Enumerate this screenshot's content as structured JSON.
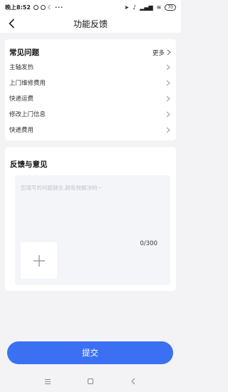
{
  "status_bar": {
    "time": "晚上8:52",
    "battery": "70"
  },
  "header": {
    "title": "功能反馈"
  },
  "faq": {
    "title": "常见问题",
    "more_label": "更多",
    "items": [
      {
        "label": "主轴发热"
      },
      {
        "label": "上门维修费用"
      },
      {
        "label": "快递运费"
      },
      {
        "label": "修改上门信息"
      },
      {
        "label": "快递费用"
      }
    ]
  },
  "feedback": {
    "title": "反馈与意见",
    "placeholder": "您填写的问题越全,越有效解决哟~",
    "counter": "0/300"
  },
  "submit_label": "提交",
  "colors": {
    "accent": "#3b70f3",
    "background": "#f3f3f5",
    "card": "#ffffff",
    "input_bg": "#f4f5f9"
  },
  "icons": {
    "back": "chevron-left-icon",
    "row": "chevron-right-icon",
    "upload": "plus-icon",
    "system_nav": [
      "menu-icon",
      "home-square-icon",
      "back-triangle-icon"
    ]
  }
}
